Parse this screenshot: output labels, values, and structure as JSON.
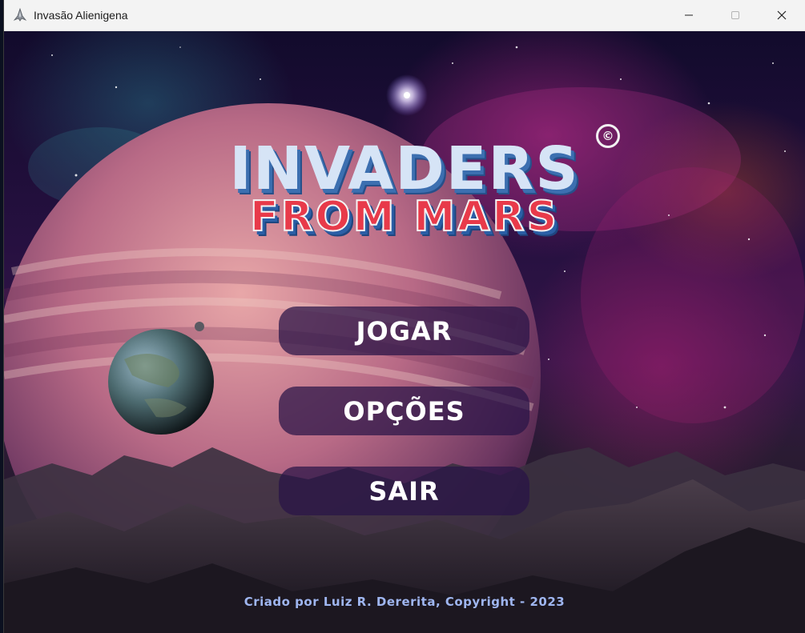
{
  "window": {
    "title": "Invasão Alienigena",
    "icon": "spaceship-icon",
    "controls": [
      "minimize-icon",
      "maximize-icon",
      "close-icon"
    ]
  },
  "logo": {
    "line1": "INVADERS",
    "line2": "FROM MARS",
    "mark": "©"
  },
  "menu": {
    "play": "JOGAR",
    "options": "OPÇÕES",
    "exit": "SAIR"
  },
  "footer": {
    "credits": "Criado por Luiz R. Dererita, Copyright - 2023"
  },
  "colors": {
    "button_bg": "#28144680",
    "button_text": "#ffffff",
    "credits_text": "#9fb6f0",
    "logo_blue": "#d6e4f6",
    "logo_red": "#e83a4a"
  }
}
